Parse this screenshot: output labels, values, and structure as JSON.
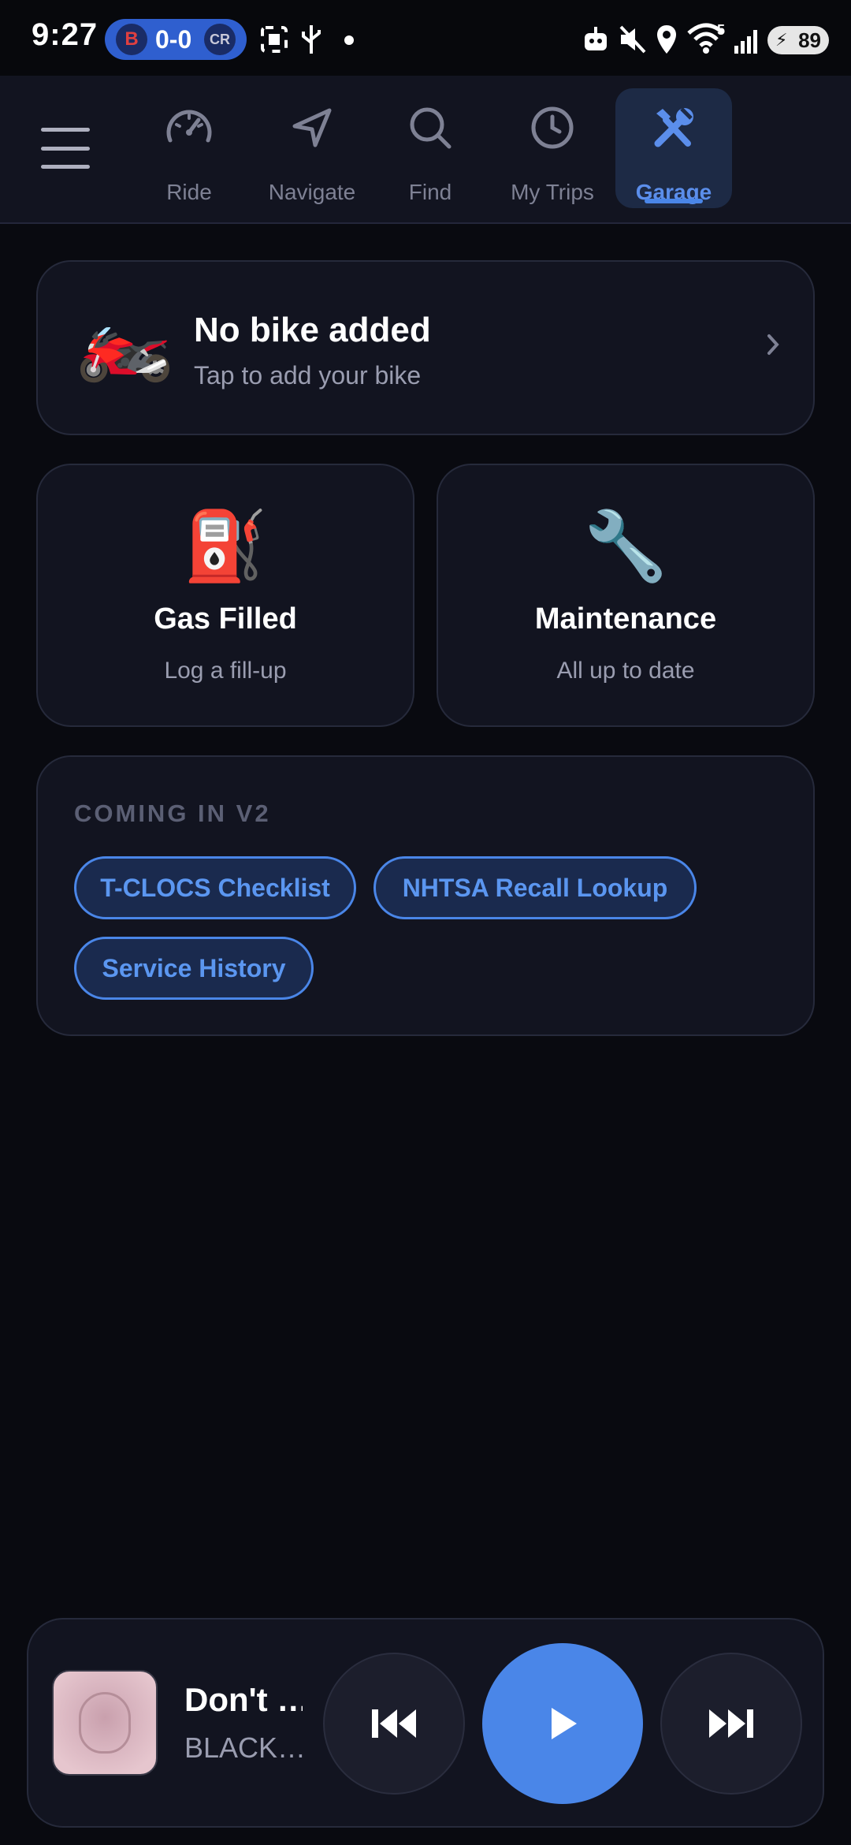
{
  "status_bar": {
    "time": "9:27",
    "score": "0-0",
    "team_home": "B",
    "team_away": "CR",
    "wifi_badge": "5",
    "battery": "89"
  },
  "nav": {
    "tabs": [
      {
        "label": "Ride",
        "icon": "speedometer-icon"
      },
      {
        "label": "Navigate",
        "icon": "navigation-arrow-icon"
      },
      {
        "label": "Find",
        "icon": "search-icon"
      },
      {
        "label": "My Trips",
        "icon": "clock-icon"
      },
      {
        "label": "Garage",
        "icon": "tools-icon",
        "active": true
      }
    ]
  },
  "bike_card": {
    "emoji": "🏍️",
    "title": "No bike added",
    "subtitle": "Tap to add your bike"
  },
  "gas_card": {
    "emoji": "⛽",
    "title": "Gas Filled",
    "subtitle": "Log a fill-up"
  },
  "maintenance_card": {
    "emoji": "🔧",
    "title": "Maintenance",
    "subtitle": "All up to date"
  },
  "coming_soon": {
    "title": "COMING IN V2",
    "chips": [
      "T-CLOCS Checklist",
      "NHTSA Recall Lookup",
      "Service History"
    ]
  },
  "player": {
    "song_title": "Don't …",
    "artist": "BLACK…"
  },
  "colors": {
    "background": "#090a10",
    "card": "#121420",
    "accent": "#4a86e8"
  }
}
